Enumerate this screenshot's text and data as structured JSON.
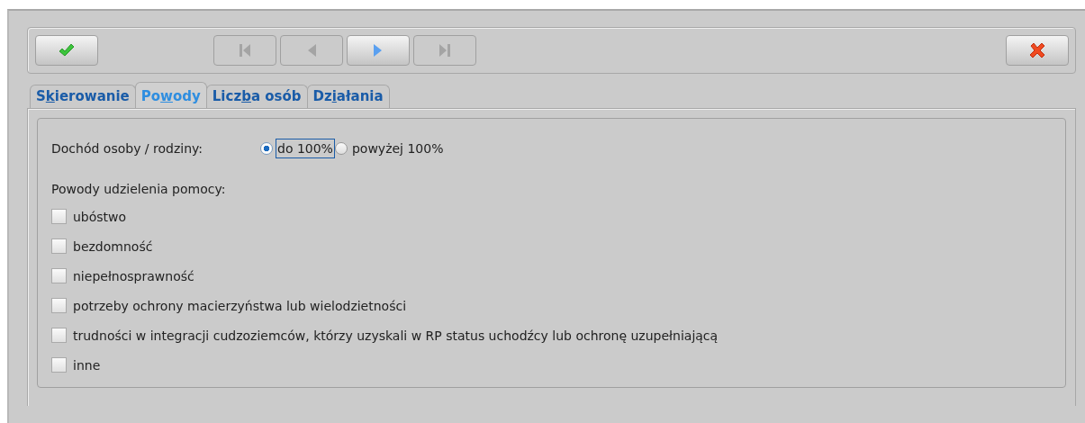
{
  "toolbar": {
    "buttons": [
      {
        "kind": "ok",
        "disabled": false
      },
      {
        "kind": "first",
        "disabled": true
      },
      {
        "kind": "prev",
        "disabled": true
      },
      {
        "kind": "next",
        "disabled": false
      },
      {
        "kind": "last",
        "disabled": true
      },
      {
        "kind": "cancel",
        "disabled": false
      }
    ]
  },
  "tabs": [
    {
      "before": "S",
      "key": "k",
      "after": "ierowanie",
      "selected": false
    },
    {
      "before": "Po",
      "key": "w",
      "after": "ody",
      "selected": true
    },
    {
      "before": "Licz",
      "key": "b",
      "after": "a osób",
      "selected": false
    },
    {
      "before": "Dz",
      "key": "i",
      "after": "ałania",
      "selected": false
    }
  ],
  "income": {
    "label": "Dochód osoby / rodziny:",
    "options": [
      {
        "label": "do 100%",
        "selected": true
      },
      {
        "label": "powyżej 100%",
        "selected": false
      }
    ]
  },
  "reasons": {
    "label": "Powody udzielenia pomocy:",
    "items": [
      {
        "label": "ubóstwo",
        "checked": false
      },
      {
        "label": "bezdomność",
        "checked": false
      },
      {
        "label": "niepełnosprawność",
        "checked": false
      },
      {
        "label": "potrzeby ochrony macierzyństwa lub wielodzietności",
        "checked": false
      },
      {
        "label": "trudności w integracji cudzoziemców, którzy uzyskali w RP status uchodźcy lub ochronę uzupełniającą",
        "checked": false
      },
      {
        "label": "inne",
        "checked": false
      }
    ]
  }
}
